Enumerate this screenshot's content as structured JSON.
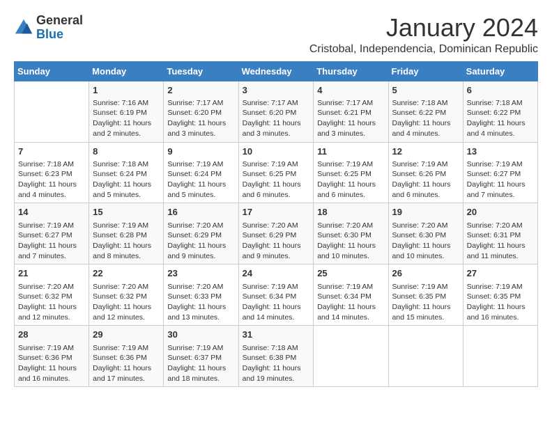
{
  "logo": {
    "general": "General",
    "blue": "Blue"
  },
  "title": {
    "month": "January 2024",
    "location": "Cristobal, Independencia, Dominican Republic"
  },
  "weekdays": [
    "Sunday",
    "Monday",
    "Tuesday",
    "Wednesday",
    "Thursday",
    "Friday",
    "Saturday"
  ],
  "weeks": [
    [
      {
        "day": "",
        "info": ""
      },
      {
        "day": "1",
        "info": "Sunrise: 7:16 AM\nSunset: 6:19 PM\nDaylight: 11 hours\nand 2 minutes."
      },
      {
        "day": "2",
        "info": "Sunrise: 7:17 AM\nSunset: 6:20 PM\nDaylight: 11 hours\nand 3 minutes."
      },
      {
        "day": "3",
        "info": "Sunrise: 7:17 AM\nSunset: 6:20 PM\nDaylight: 11 hours\nand 3 minutes."
      },
      {
        "day": "4",
        "info": "Sunrise: 7:17 AM\nSunset: 6:21 PM\nDaylight: 11 hours\nand 3 minutes."
      },
      {
        "day": "5",
        "info": "Sunrise: 7:18 AM\nSunset: 6:22 PM\nDaylight: 11 hours\nand 4 minutes."
      },
      {
        "day": "6",
        "info": "Sunrise: 7:18 AM\nSunset: 6:22 PM\nDaylight: 11 hours\nand 4 minutes."
      }
    ],
    [
      {
        "day": "7",
        "info": "Sunrise: 7:18 AM\nSunset: 6:23 PM\nDaylight: 11 hours\nand 4 minutes."
      },
      {
        "day": "8",
        "info": "Sunrise: 7:18 AM\nSunset: 6:24 PM\nDaylight: 11 hours\nand 5 minutes."
      },
      {
        "day": "9",
        "info": "Sunrise: 7:19 AM\nSunset: 6:24 PM\nDaylight: 11 hours\nand 5 minutes."
      },
      {
        "day": "10",
        "info": "Sunrise: 7:19 AM\nSunset: 6:25 PM\nDaylight: 11 hours\nand 6 minutes."
      },
      {
        "day": "11",
        "info": "Sunrise: 7:19 AM\nSunset: 6:25 PM\nDaylight: 11 hours\nand 6 minutes."
      },
      {
        "day": "12",
        "info": "Sunrise: 7:19 AM\nSunset: 6:26 PM\nDaylight: 11 hours\nand 6 minutes."
      },
      {
        "day": "13",
        "info": "Sunrise: 7:19 AM\nSunset: 6:27 PM\nDaylight: 11 hours\nand 7 minutes."
      }
    ],
    [
      {
        "day": "14",
        "info": "Sunrise: 7:19 AM\nSunset: 6:27 PM\nDaylight: 11 hours\nand 7 minutes."
      },
      {
        "day": "15",
        "info": "Sunrise: 7:19 AM\nSunset: 6:28 PM\nDaylight: 11 hours\nand 8 minutes."
      },
      {
        "day": "16",
        "info": "Sunrise: 7:20 AM\nSunset: 6:29 PM\nDaylight: 11 hours\nand 9 minutes."
      },
      {
        "day": "17",
        "info": "Sunrise: 7:20 AM\nSunset: 6:29 PM\nDaylight: 11 hours\nand 9 minutes."
      },
      {
        "day": "18",
        "info": "Sunrise: 7:20 AM\nSunset: 6:30 PM\nDaylight: 11 hours\nand 10 minutes."
      },
      {
        "day": "19",
        "info": "Sunrise: 7:20 AM\nSunset: 6:30 PM\nDaylight: 11 hours\nand 10 minutes."
      },
      {
        "day": "20",
        "info": "Sunrise: 7:20 AM\nSunset: 6:31 PM\nDaylight: 11 hours\nand 11 minutes."
      }
    ],
    [
      {
        "day": "21",
        "info": "Sunrise: 7:20 AM\nSunset: 6:32 PM\nDaylight: 11 hours\nand 12 minutes."
      },
      {
        "day": "22",
        "info": "Sunrise: 7:20 AM\nSunset: 6:32 PM\nDaylight: 11 hours\nand 12 minutes."
      },
      {
        "day": "23",
        "info": "Sunrise: 7:20 AM\nSunset: 6:33 PM\nDaylight: 11 hours\nand 13 minutes."
      },
      {
        "day": "24",
        "info": "Sunrise: 7:19 AM\nSunset: 6:34 PM\nDaylight: 11 hours\nand 14 minutes."
      },
      {
        "day": "25",
        "info": "Sunrise: 7:19 AM\nSunset: 6:34 PM\nDaylight: 11 hours\nand 14 minutes."
      },
      {
        "day": "26",
        "info": "Sunrise: 7:19 AM\nSunset: 6:35 PM\nDaylight: 11 hours\nand 15 minutes."
      },
      {
        "day": "27",
        "info": "Sunrise: 7:19 AM\nSunset: 6:35 PM\nDaylight: 11 hours\nand 16 minutes."
      }
    ],
    [
      {
        "day": "28",
        "info": "Sunrise: 7:19 AM\nSunset: 6:36 PM\nDaylight: 11 hours\nand 16 minutes."
      },
      {
        "day": "29",
        "info": "Sunrise: 7:19 AM\nSunset: 6:36 PM\nDaylight: 11 hours\nand 17 minutes."
      },
      {
        "day": "30",
        "info": "Sunrise: 7:19 AM\nSunset: 6:37 PM\nDaylight: 11 hours\nand 18 minutes."
      },
      {
        "day": "31",
        "info": "Sunrise: 7:18 AM\nSunset: 6:38 PM\nDaylight: 11 hours\nand 19 minutes."
      },
      {
        "day": "",
        "info": ""
      },
      {
        "day": "",
        "info": ""
      },
      {
        "day": "",
        "info": ""
      }
    ]
  ]
}
